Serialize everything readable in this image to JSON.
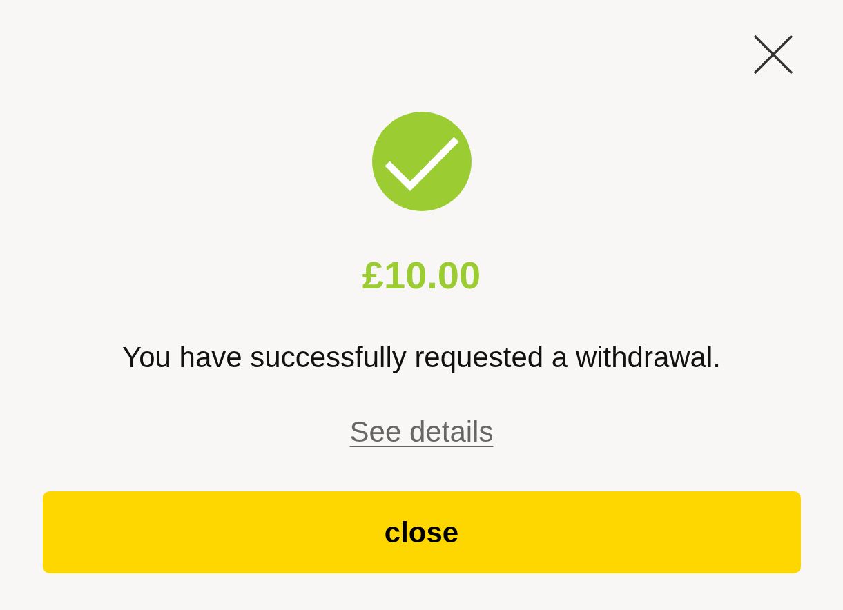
{
  "amount": "£10.00",
  "message": "You have successfully requested a withdrawal.",
  "details_link": "See details",
  "button": "close"
}
